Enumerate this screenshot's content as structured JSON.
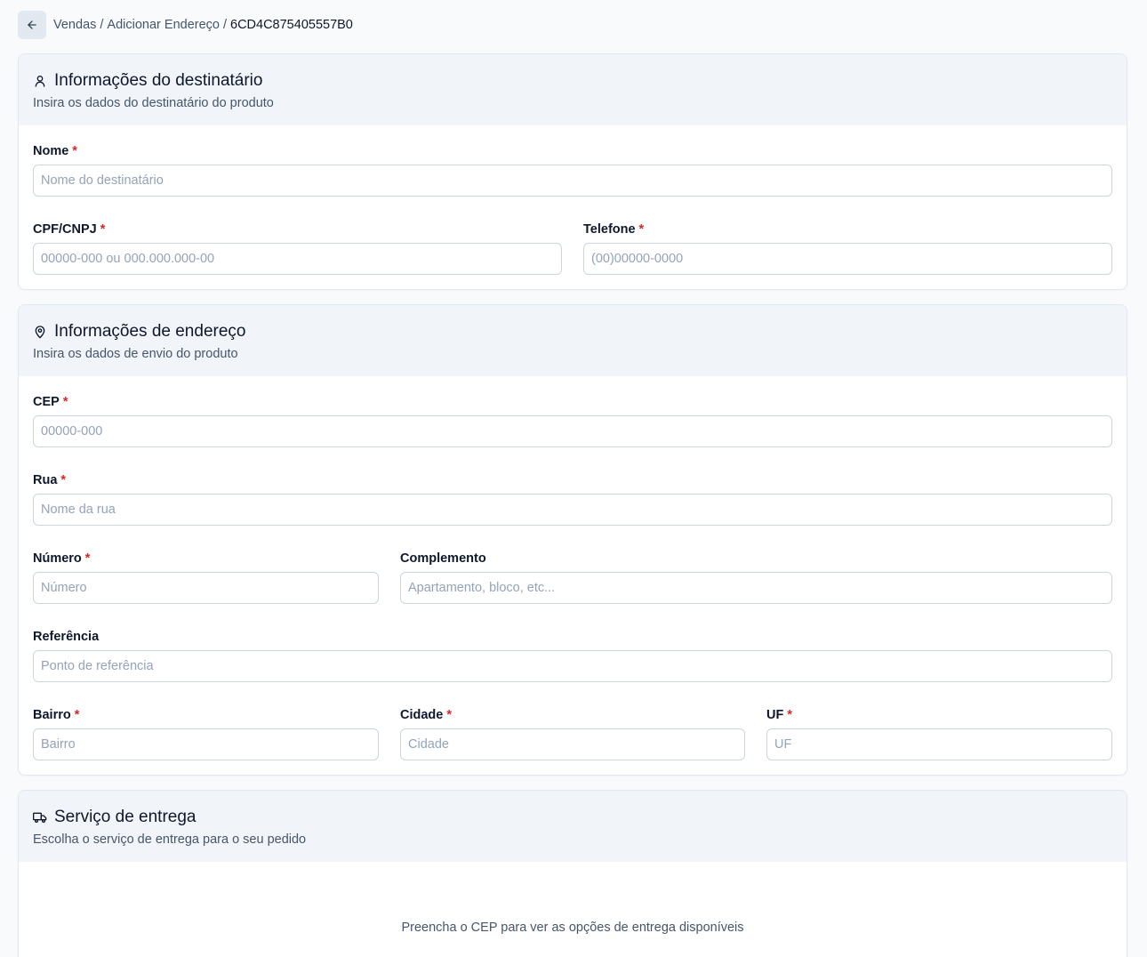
{
  "breadcrumb": {
    "items": [
      "Vendas",
      "Adicionar Endereço"
    ],
    "separator": "/",
    "current": "6CD4C875405557B0"
  },
  "recipient": {
    "title": "Informações do destinatário",
    "subtitle": "Insira os dados do destinatário do produto",
    "icon": "user-icon",
    "name": {
      "label": "Nome",
      "required": "*",
      "placeholder": "Nome do destinatário",
      "value": ""
    },
    "document": {
      "label": "CPF/CNPJ",
      "required": "*",
      "placeholder": "00000-000 ou 000.000.000-00",
      "value": ""
    },
    "phone": {
      "label": "Telefone",
      "required": "*",
      "placeholder": "(00)00000-0000",
      "value": ""
    }
  },
  "address": {
    "title": "Informações de endereço",
    "subtitle": "Insira os dados de envio do produto",
    "icon": "map-pin-icon",
    "cep": {
      "label": "CEP",
      "required": "*",
      "placeholder": "00000-000",
      "value": ""
    },
    "street": {
      "label": "Rua",
      "required": "*",
      "placeholder": "Nome da rua",
      "value": ""
    },
    "number": {
      "label": "Número",
      "required": "*",
      "placeholder": "Número",
      "value": ""
    },
    "complement": {
      "label": "Complemento",
      "placeholder": "Apartamento, bloco, etc...",
      "value": ""
    },
    "reference": {
      "label": "Referência",
      "placeholder": "Ponto de referência",
      "value": ""
    },
    "district": {
      "label": "Bairro",
      "required": "*",
      "placeholder": "Bairro",
      "value": ""
    },
    "city": {
      "label": "Cidade",
      "required": "*",
      "placeholder": "Cidade",
      "value": ""
    },
    "state": {
      "label": "UF",
      "required": "*",
      "placeholder": "UF",
      "value": ""
    }
  },
  "delivery": {
    "title": "Serviço de entrega",
    "subtitle": "Escolha o serviço de entrega para o seu pedido",
    "icon": "truck-icon",
    "empty_message": "Preencha o CEP para ver as opções de entrega disponíveis"
  },
  "colors": {
    "page_bg": "#f8fafc",
    "card_header_bg": "#f1f5f9",
    "border": "#cbd5e1",
    "required": "#dc2626",
    "muted_text": "#475569"
  }
}
